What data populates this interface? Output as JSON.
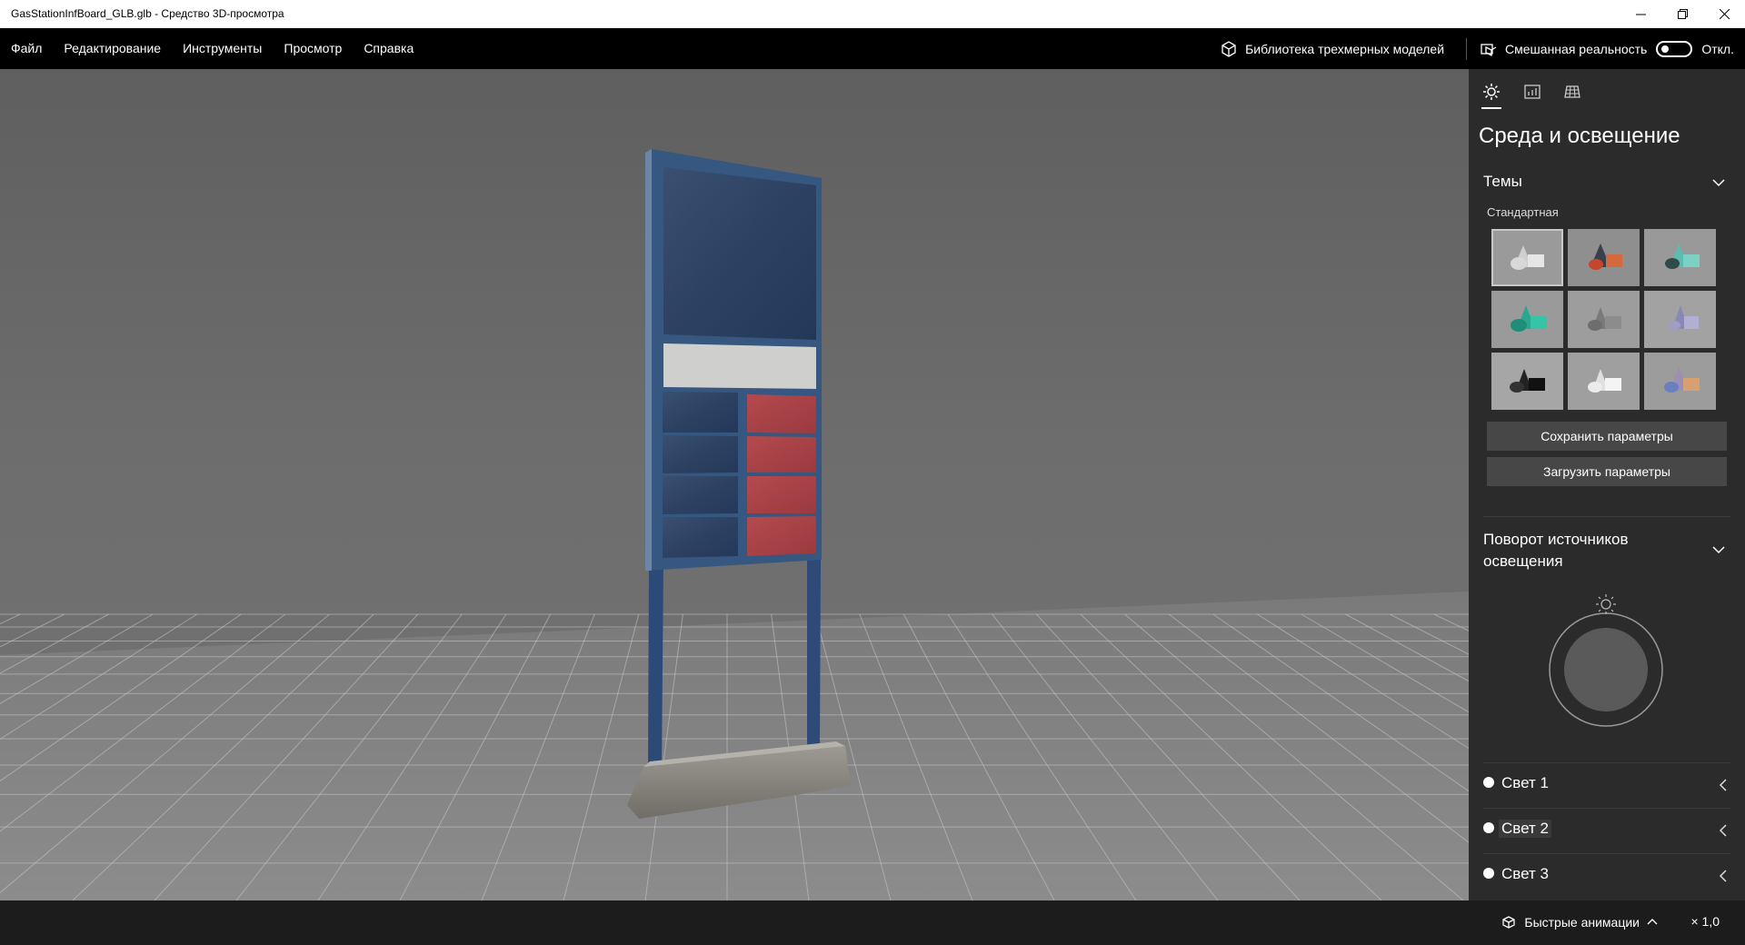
{
  "window": {
    "title": "GasStationInfBoard_GLB.glb - Средство 3D-просмотра"
  },
  "menu": {
    "items": [
      "Файл",
      "Редактирование",
      "Инструменты",
      "Просмотр",
      "Справка"
    ],
    "library_label": "Библиотека трехмерных моделей",
    "mixed_reality_label": "Смешанная реальность",
    "mixed_reality_state": "Откл."
  },
  "panel": {
    "tabs": [
      "sun-icon",
      "stats-icon",
      "grid-icon"
    ],
    "title": "Среда и освещение",
    "themes": {
      "heading": "Темы",
      "group_label": "Стандартная",
      "selected_index": 0
    },
    "save_button": "Сохранить параметры",
    "load_button": "Загрузить параметры",
    "rotation": {
      "heading_line1": "Поворот источников",
      "heading_line2": "освещения"
    },
    "lights": [
      "Свет 1",
      "Свет 2",
      "Свет 3"
    ]
  },
  "statusbar": {
    "animations_label": "Быстрые анимации",
    "speed": "× 1,0"
  },
  "colors": {
    "background": "#1f1f1f",
    "panel": "#2b2b2b",
    "button": "#474747",
    "viewport": "#6b6b6b"
  }
}
